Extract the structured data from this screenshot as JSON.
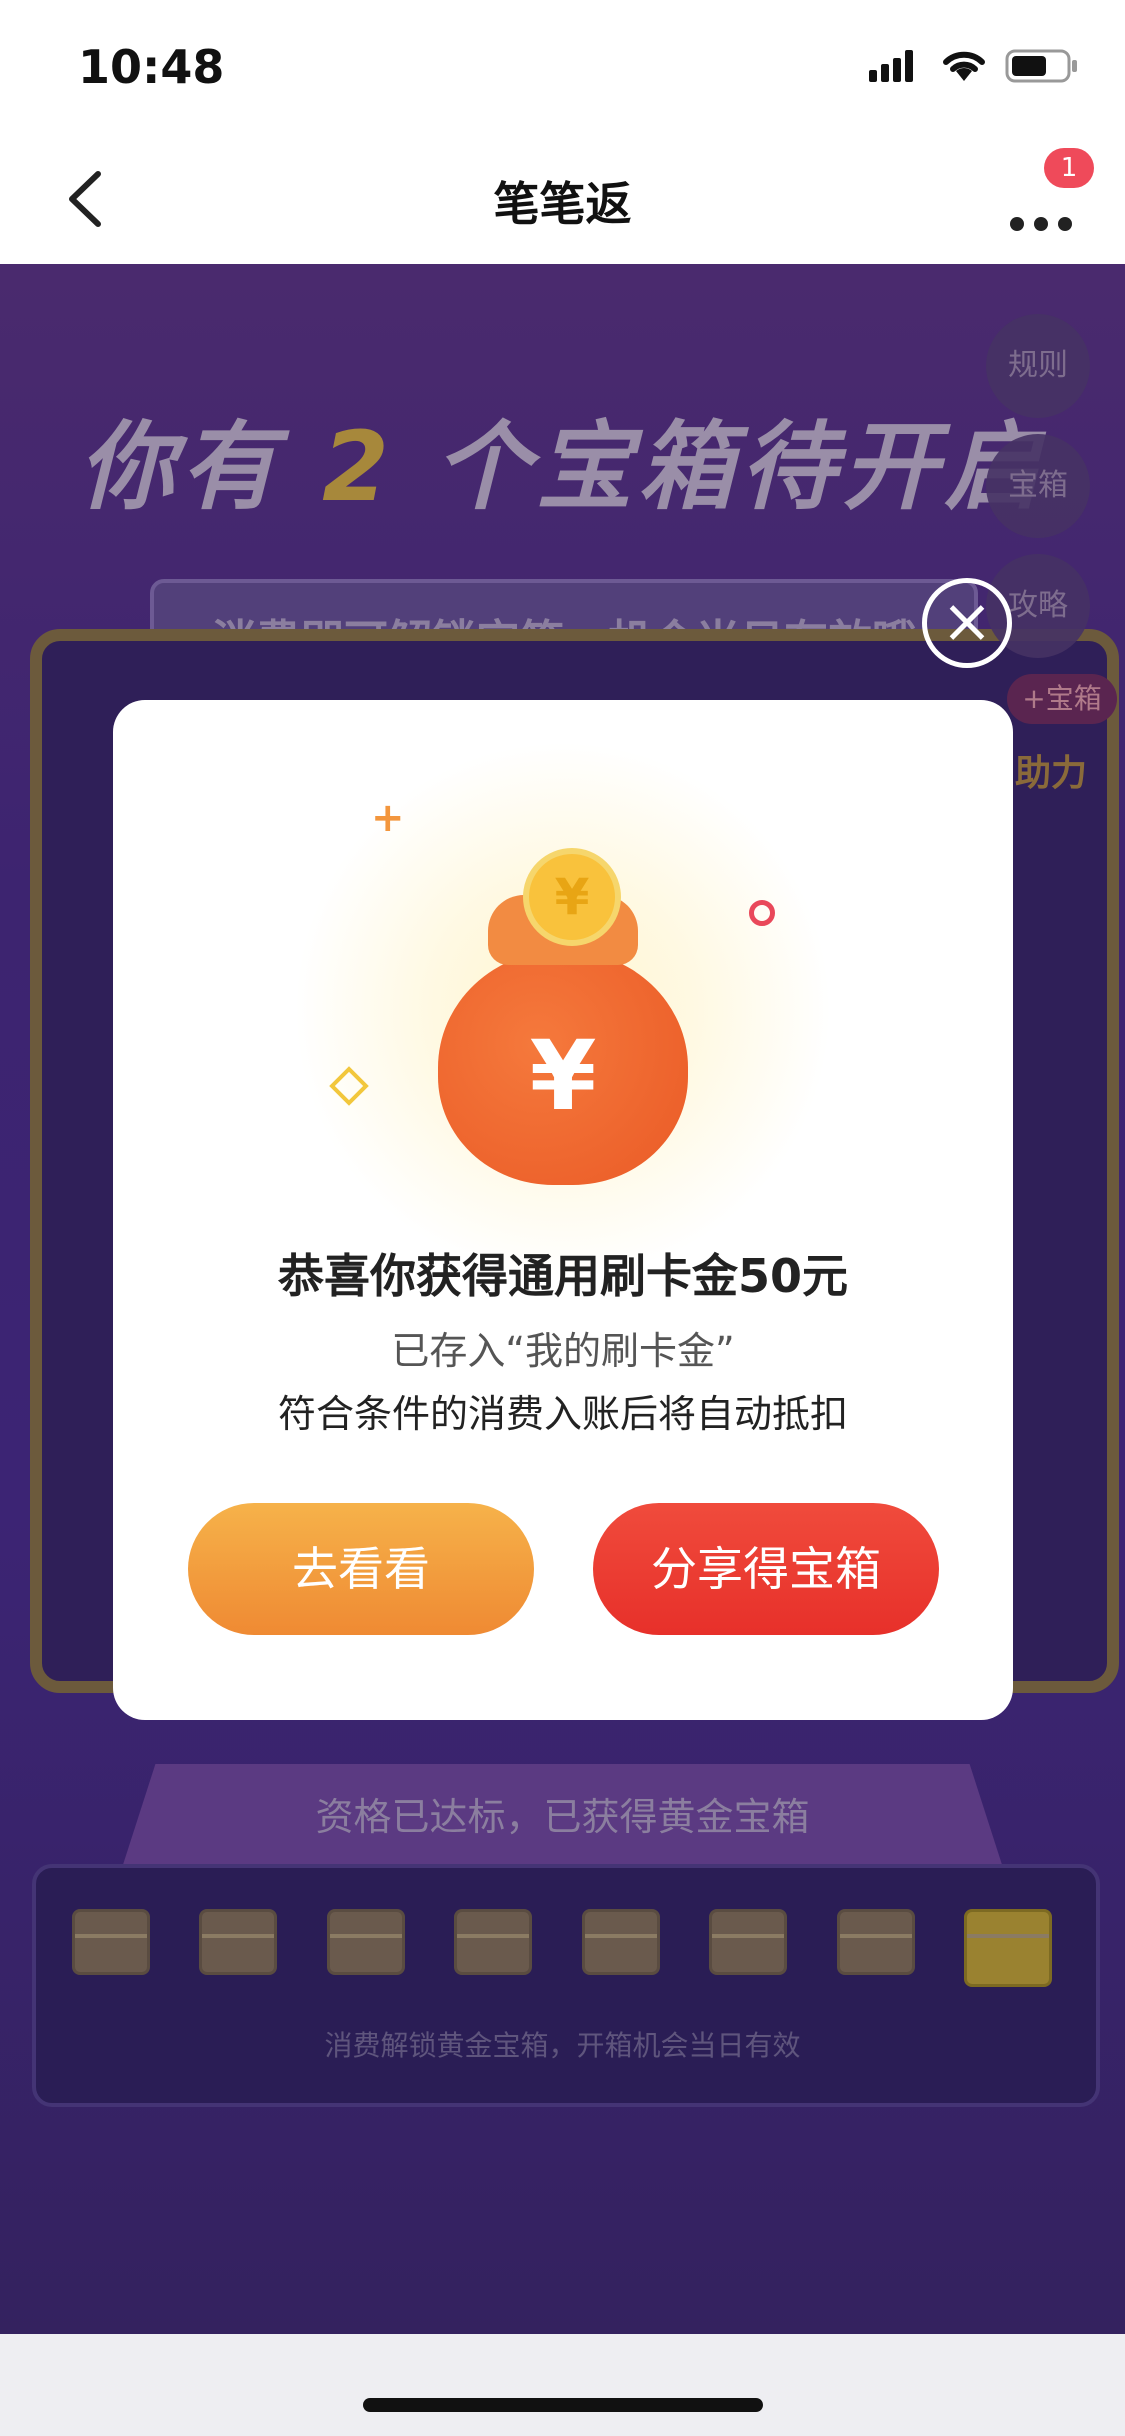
{
  "status_bar": {
    "time": "10:48"
  },
  "nav": {
    "title": "笔笔返",
    "badge_count": "1"
  },
  "background": {
    "headline_prefix": "你有",
    "headline_count": "2",
    "headline_suffix": "个宝箱待开启",
    "sub_banner": "消费即可解锁宝箱，机会当日有效哦",
    "side_buttons": [
      "规则",
      "宝箱",
      "攻略"
    ],
    "boost_badge": "+宝箱",
    "boost_label": "助力",
    "tab_text": "资格已达标，已获得黄金宝箱",
    "chest_caption": "消费解锁黄金宝箱，开箱机会当日有效"
  },
  "modal": {
    "title": "恭喜你获得通用刷卡金50元",
    "line1": "已存入“我的刷卡金”",
    "line2": "符合条件的消费入账后将自动抵扣",
    "bag_yen": "¥",
    "coin_yen": "¥",
    "btn_look": "去看看",
    "btn_share": "分享得宝箱"
  },
  "icons": {
    "back": "chevron-left-icon",
    "more": "more-dots-icon",
    "close": "close-icon",
    "signal": "signal-icon",
    "wifi": "wifi-icon",
    "battery": "battery-icon"
  },
  "colors": {
    "accent_orange": "#ef8a33",
    "accent_red": "#e7302a",
    "badge_red": "#ef4a5a",
    "bg_purple": "#3c2474"
  }
}
